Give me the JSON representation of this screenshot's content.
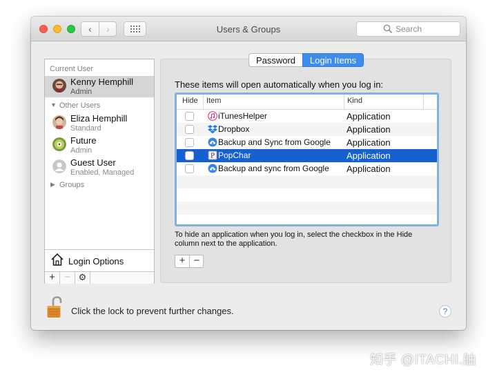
{
  "window": {
    "title": "Users & Groups"
  },
  "search": {
    "placeholder": "Search"
  },
  "sidebar": {
    "current_user_heading": "Current User",
    "current_user": {
      "name": "Kenny Hemphill",
      "role": "Admin"
    },
    "other_users_heading": "Other Users",
    "other_users": [
      {
        "name": "Eliza Hemphill",
        "role": "Standard"
      },
      {
        "name": "Future",
        "role": "Admin"
      },
      {
        "name": "Guest User",
        "role": "Enabled, Managed"
      }
    ],
    "groups_label": "Groups",
    "login_options_label": "Login Options",
    "bottom_buttons": {
      "add": "+",
      "remove": "−",
      "action": "⚙"
    }
  },
  "tabs": {
    "password": "Password",
    "login_items": "Login Items",
    "selected": "Login Items"
  },
  "login_items": {
    "intro": "These items will open automatically when you log in:",
    "columns": {
      "hide": "Hide",
      "item": "Item",
      "kind": "Kind"
    },
    "rows": [
      {
        "item": "iTunesHelper",
        "kind": "Application",
        "icon": "itunes-icon"
      },
      {
        "item": "Dropbox",
        "kind": "Application",
        "icon": "dropbox-icon"
      },
      {
        "item": "Backup and Sync from Google",
        "kind": "Application",
        "icon": "google-backup-icon"
      },
      {
        "item": "PopChar",
        "kind": "Application",
        "icon": "popchar-icon"
      },
      {
        "item": "Backup and sync from Google",
        "kind": "Application",
        "icon": "google-backup-icon"
      }
    ],
    "selected_row": "PopChar",
    "help_text": "To hide an application when you log in, select the checkbox in the Hide column next to the application.",
    "add_label": "+",
    "remove_label": "−"
  },
  "footer": {
    "lock_text": "Click the lock to prevent further changes.",
    "help_label": "?"
  },
  "watermark": "知乎 @ITACHI.舳",
  "colors": {
    "accent": "#3d8dee",
    "selection": "#1561d2"
  }
}
